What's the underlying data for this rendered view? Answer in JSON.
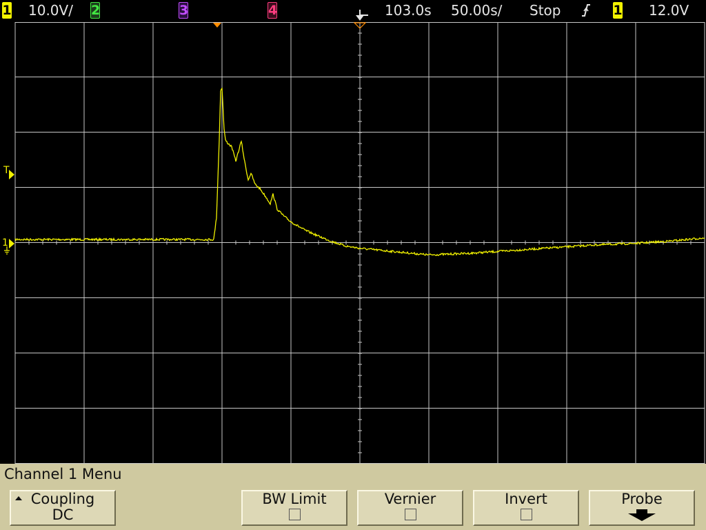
{
  "status_bar": {
    "ch1_number": "1",
    "ch1_scale": "10.0V/",
    "ch2_number": "2",
    "ch3_number": "3",
    "ch4_number": "4",
    "time_delay": "103.0s",
    "time_scale": "50.00s/",
    "run_state": "Stop",
    "trigger_slope_icon": "rising-edge-icon",
    "trigger_source": "1",
    "trigger_level": "12.0V"
  },
  "display": {
    "ground_marker_label": "1",
    "trigger_level_marker_label": "T"
  },
  "colors": {
    "ch1": "#f2f200",
    "ch2": "#43e843",
    "ch3": "#c24dff",
    "ch4": "#ff3d7f",
    "trigger_marker": "#ff8c00",
    "grid": "#c8c8c8",
    "menu_background": "#cfc9a0"
  },
  "menu": {
    "title": "Channel 1  Menu",
    "softkeys": [
      {
        "label": "Coupling",
        "value": "DC"
      },
      {
        "label": "BW Limit"
      },
      {
        "label": "Vernier"
      },
      {
        "label": "Invert"
      },
      {
        "label": "Probe"
      }
    ]
  }
}
